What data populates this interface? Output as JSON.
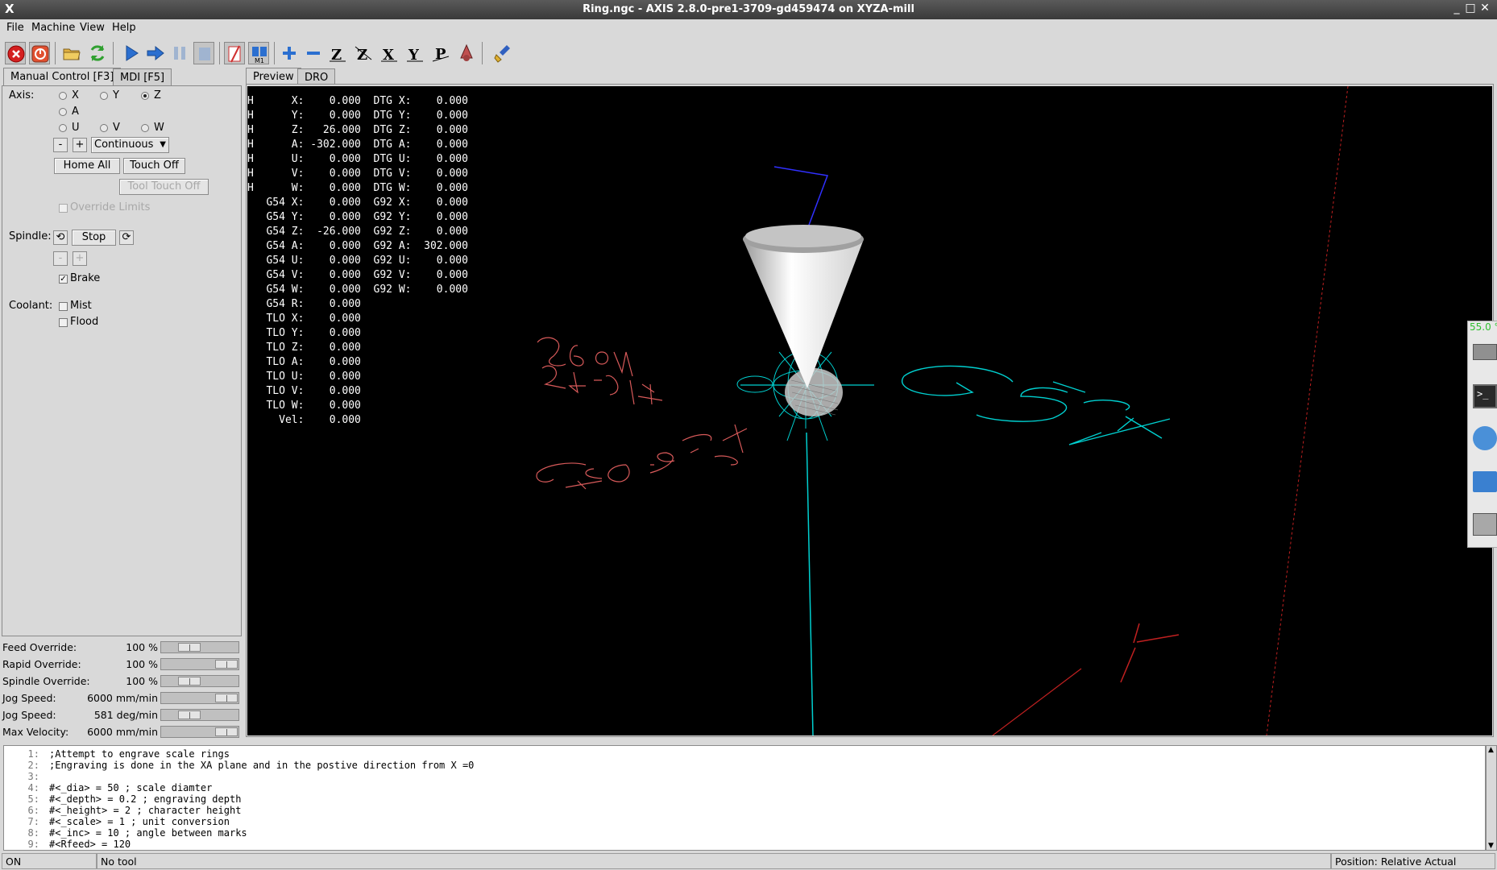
{
  "window": {
    "title": "Ring.ngc - AXIS 2.8.0-pre1-3709-gd459474 on XYZA-mill",
    "logo": "X",
    "controls": [
      "_",
      "□",
      "✕"
    ]
  },
  "menu": [
    "File",
    "Machine",
    "View",
    "Help"
  ],
  "toolbar": {
    "icons": [
      "estop-icon",
      "power-icon",
      "open-file-icon",
      "reload-icon",
      "run-icon",
      "step-icon",
      "pause-icon",
      "stop-icon",
      "block-delete-icon",
      "optional-stop-icon",
      "zoom-in-icon",
      "zoom-out-icon",
      "view-z-icon",
      "view-z2-icon",
      "view-x-icon",
      "view-y-icon",
      "view-p-icon",
      "rotate-view-icon",
      "clear-backplot-icon"
    ]
  },
  "left_tabs": [
    "Manual Control [F3]",
    "MDI [F5]"
  ],
  "manual": {
    "axis_label": "Axis:",
    "axes": [
      "X",
      "Y",
      "Z",
      "A",
      "U",
      "V",
      "W"
    ],
    "selected_axis": "Z",
    "jog_minus": "-",
    "jog_plus": "+",
    "jog_mode": "Continuous",
    "home_all": "Home All",
    "touch_off": "Touch Off",
    "tool_touch_off": "Tool Touch Off",
    "override_limits": "Override Limits",
    "spindle_label": "Spindle:",
    "spindle_stop": "Stop",
    "spindle_minus": "-",
    "spindle_plus": "+",
    "brake": "Brake",
    "brake_checked": true,
    "coolant_label": "Coolant:",
    "mist": "Mist",
    "flood": "Flood"
  },
  "overrides": [
    {
      "label": "Feed Override:",
      "value": "100 %",
      "level": 0.3
    },
    {
      "label": "Rapid Override:",
      "value": "100 %",
      "level": 1.0
    },
    {
      "label": "Spindle Override:",
      "value": "100 %",
      "level": 0.3
    },
    {
      "label": "Jog Speed:",
      "value": "6000 mm/min",
      "level": 1.0
    },
    {
      "label": "Jog Speed:",
      "value": "581 deg/min",
      "level": 0.3
    },
    {
      "label": "Max Velocity:",
      "value": "6000 mm/min",
      "level": 1.0
    }
  ],
  "preview_tabs": [
    "Preview",
    "DRO"
  ],
  "dro": {
    "rows": [
      "H      X:    0.000  DTG X:    0.000",
      "H      Y:    0.000  DTG Y:    0.000",
      "H      Z:   26.000  DTG Z:    0.000",
      "H      A: -302.000  DTG A:    0.000",
      "H      U:    0.000  DTG U:    0.000",
      "H      V:    0.000  DTG V:    0.000",
      "H      W:    0.000  DTG W:    0.000",
      "   G54 X:    0.000  G92 X:    0.000",
      "   G54 Y:    0.000  G92 Y:    0.000",
      "   G54 Z:  -26.000  G92 Z:    0.000",
      "   G54 A:    0.000  G92 A:  302.000",
      "   G54 U:    0.000  G92 U:    0.000",
      "   G54 V:    0.000  G92 V:    0.000",
      "   G54 W:    0.000  G92 W:    0.000",
      "   G54 R:    0.000",
      "   TLO X:    0.000",
      "   TLO Y:    0.000",
      "   TLO Z:    0.000",
      "   TLO A:    0.000",
      "   TLO U:    0.000",
      "   TLO V:    0.000",
      "   TLO W:    0.000",
      "     Vel:    0.000"
    ]
  },
  "gcode": [
    {
      "n": "1:",
      "text": ";Attempt to engrave scale rings"
    },
    {
      "n": "2:",
      "text": ";Engraving is done in the XA plane and in the postive direction from X =0"
    },
    {
      "n": "3:",
      "text": ""
    },
    {
      "n": "4:",
      "text": "#<_dia> = 50 ; scale diamter"
    },
    {
      "n": "5:",
      "text": "#<_depth> = 0.2 ; engraving depth"
    },
    {
      "n": "6:",
      "text": "#<_height> = 2 ; character height"
    },
    {
      "n": "7:",
      "text": "#<_scale> = 1 ; unit conversion"
    },
    {
      "n": "8:",
      "text": "#<_inc> = 10 ; angle between marks"
    },
    {
      "n": "9:",
      "text": "#<Rfeed> = 120"
    }
  ],
  "status": {
    "state": "ON",
    "tool": "No tool",
    "position": "Position: Relative Actual"
  },
  "dock": {
    "temp": "55.0 °"
  },
  "colors": {
    "preview_bg": "#000000",
    "cyan": "#00d8d8",
    "red": "#cc2222",
    "salmon": "#e06060",
    "blue": "#3030ff"
  }
}
